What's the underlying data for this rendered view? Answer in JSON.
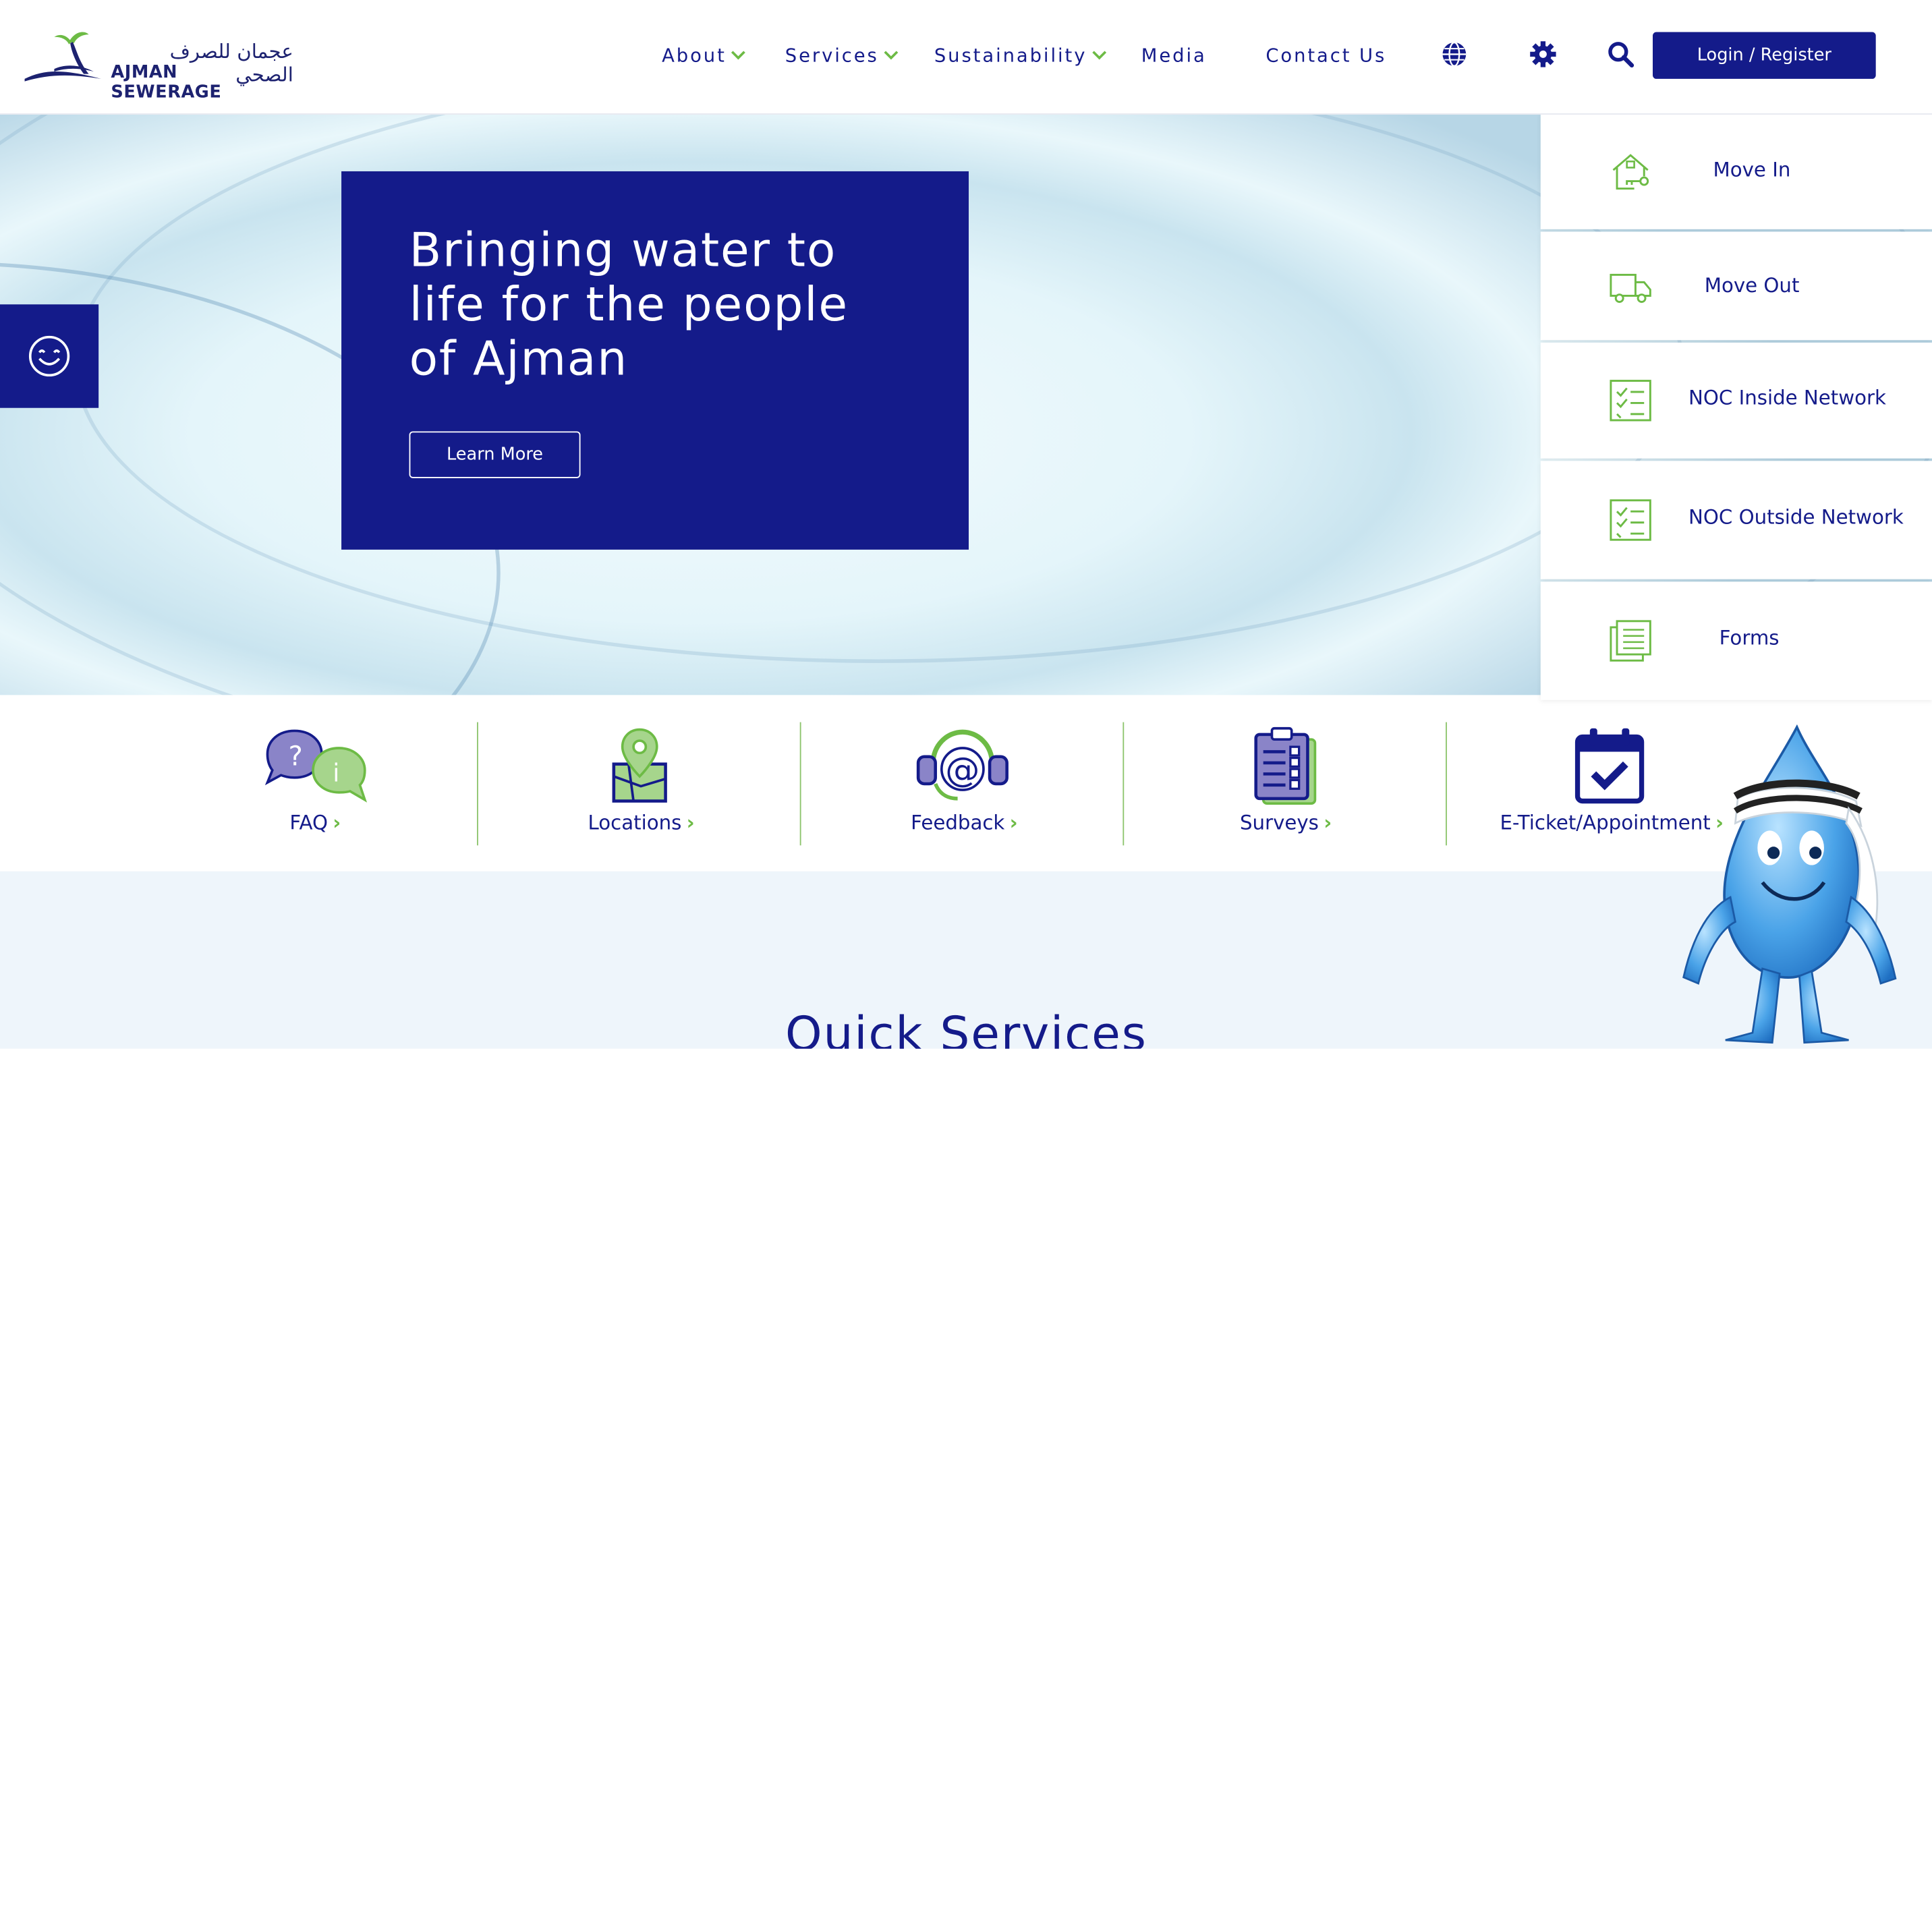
{
  "header": {
    "logo_arabic": "عجمان للصرف الصحي",
    "logo_english": "AJMAN SEWERAGE",
    "nav": [
      {
        "label": "About",
        "has_dropdown": true
      },
      {
        "label": "Services",
        "has_dropdown": true
      },
      {
        "label": "Sustainability",
        "has_dropdown": true
      },
      {
        "label": "Media",
        "has_dropdown": false
      },
      {
        "label": "Contact Us",
        "has_dropdown": false
      }
    ],
    "dropdown_chevron": "⌄",
    "icons": [
      "globe-icon",
      "gear-icon",
      "search-icon"
    ],
    "login_label": "Login / Register"
  },
  "hero": {
    "title": "Bringing water to life for the people of Ajman",
    "cta_label": "Learn More"
  },
  "side_panel": [
    {
      "label": "Move In",
      "icon": "house-key-icon"
    },
    {
      "label": "Move Out",
      "icon": "truck-icon"
    },
    {
      "label": "NOC Inside Network",
      "icon": "checklist-icon"
    },
    {
      "label": "NOC Outside Network",
      "icon": "checklist-icon"
    },
    {
      "label": "Forms",
      "icon": "documents-icon"
    }
  ],
  "quick_links": [
    {
      "label": "FAQ",
      "icon": "faq-bubbles-icon"
    },
    {
      "label": "Locations",
      "icon": "map-pin-icon"
    },
    {
      "label": "Feedback",
      "icon": "headset-at-icon"
    },
    {
      "label": "Surveys",
      "icon": "clipboard-icon"
    },
    {
      "label": "E-Ticket/Appointment",
      "icon": "calendar-check-icon"
    }
  ],
  "quick_link_arrow": "›",
  "section_title": "Quick Services",
  "colors": {
    "brand_navy": "#141b8a",
    "accent_green": "#6dbb45",
    "hero_water": "#e4f5fa"
  }
}
